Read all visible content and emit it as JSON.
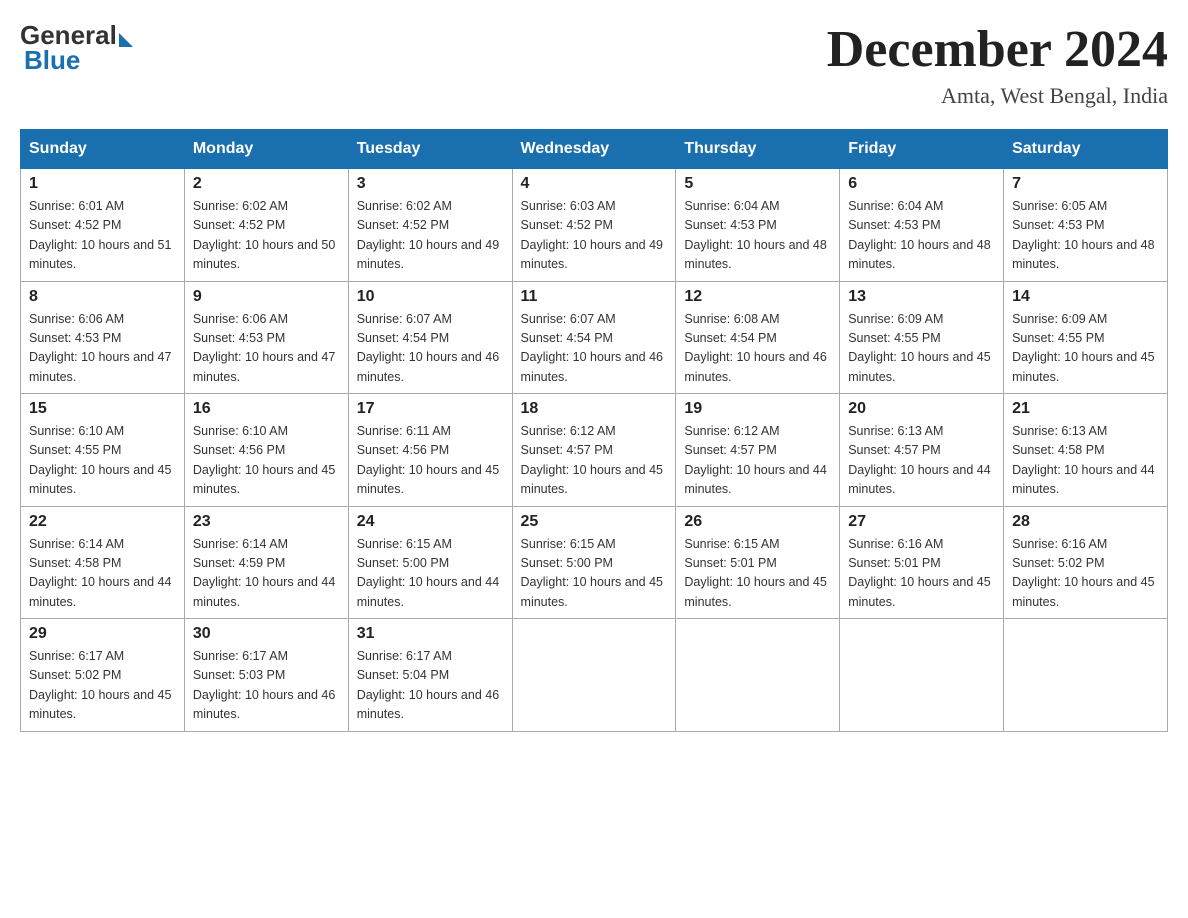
{
  "logo": {
    "general": "General",
    "blue": "Blue"
  },
  "title": "December 2024",
  "location": "Amta, West Bengal, India",
  "weekdays": [
    "Sunday",
    "Monday",
    "Tuesday",
    "Wednesday",
    "Thursday",
    "Friday",
    "Saturday"
  ],
  "weeks": [
    [
      {
        "day": 1,
        "sunrise": "6:01 AM",
        "sunset": "4:52 PM",
        "daylight": "10 hours and 51 minutes."
      },
      {
        "day": 2,
        "sunrise": "6:02 AM",
        "sunset": "4:52 PM",
        "daylight": "10 hours and 50 minutes."
      },
      {
        "day": 3,
        "sunrise": "6:02 AM",
        "sunset": "4:52 PM",
        "daylight": "10 hours and 49 minutes."
      },
      {
        "day": 4,
        "sunrise": "6:03 AM",
        "sunset": "4:52 PM",
        "daylight": "10 hours and 49 minutes."
      },
      {
        "day": 5,
        "sunrise": "6:04 AM",
        "sunset": "4:53 PM",
        "daylight": "10 hours and 48 minutes."
      },
      {
        "day": 6,
        "sunrise": "6:04 AM",
        "sunset": "4:53 PM",
        "daylight": "10 hours and 48 minutes."
      },
      {
        "day": 7,
        "sunrise": "6:05 AM",
        "sunset": "4:53 PM",
        "daylight": "10 hours and 48 minutes."
      }
    ],
    [
      {
        "day": 8,
        "sunrise": "6:06 AM",
        "sunset": "4:53 PM",
        "daylight": "10 hours and 47 minutes."
      },
      {
        "day": 9,
        "sunrise": "6:06 AM",
        "sunset": "4:53 PM",
        "daylight": "10 hours and 47 minutes."
      },
      {
        "day": 10,
        "sunrise": "6:07 AM",
        "sunset": "4:54 PM",
        "daylight": "10 hours and 46 minutes."
      },
      {
        "day": 11,
        "sunrise": "6:07 AM",
        "sunset": "4:54 PM",
        "daylight": "10 hours and 46 minutes."
      },
      {
        "day": 12,
        "sunrise": "6:08 AM",
        "sunset": "4:54 PM",
        "daylight": "10 hours and 46 minutes."
      },
      {
        "day": 13,
        "sunrise": "6:09 AM",
        "sunset": "4:55 PM",
        "daylight": "10 hours and 45 minutes."
      },
      {
        "day": 14,
        "sunrise": "6:09 AM",
        "sunset": "4:55 PM",
        "daylight": "10 hours and 45 minutes."
      }
    ],
    [
      {
        "day": 15,
        "sunrise": "6:10 AM",
        "sunset": "4:55 PM",
        "daylight": "10 hours and 45 minutes."
      },
      {
        "day": 16,
        "sunrise": "6:10 AM",
        "sunset": "4:56 PM",
        "daylight": "10 hours and 45 minutes."
      },
      {
        "day": 17,
        "sunrise": "6:11 AM",
        "sunset": "4:56 PM",
        "daylight": "10 hours and 45 minutes."
      },
      {
        "day": 18,
        "sunrise": "6:12 AM",
        "sunset": "4:57 PM",
        "daylight": "10 hours and 45 minutes."
      },
      {
        "day": 19,
        "sunrise": "6:12 AM",
        "sunset": "4:57 PM",
        "daylight": "10 hours and 44 minutes."
      },
      {
        "day": 20,
        "sunrise": "6:13 AM",
        "sunset": "4:57 PM",
        "daylight": "10 hours and 44 minutes."
      },
      {
        "day": 21,
        "sunrise": "6:13 AM",
        "sunset": "4:58 PM",
        "daylight": "10 hours and 44 minutes."
      }
    ],
    [
      {
        "day": 22,
        "sunrise": "6:14 AM",
        "sunset": "4:58 PM",
        "daylight": "10 hours and 44 minutes."
      },
      {
        "day": 23,
        "sunrise": "6:14 AM",
        "sunset": "4:59 PM",
        "daylight": "10 hours and 44 minutes."
      },
      {
        "day": 24,
        "sunrise": "6:15 AM",
        "sunset": "5:00 PM",
        "daylight": "10 hours and 44 minutes."
      },
      {
        "day": 25,
        "sunrise": "6:15 AM",
        "sunset": "5:00 PM",
        "daylight": "10 hours and 45 minutes."
      },
      {
        "day": 26,
        "sunrise": "6:15 AM",
        "sunset": "5:01 PM",
        "daylight": "10 hours and 45 minutes."
      },
      {
        "day": 27,
        "sunrise": "6:16 AM",
        "sunset": "5:01 PM",
        "daylight": "10 hours and 45 minutes."
      },
      {
        "day": 28,
        "sunrise": "6:16 AM",
        "sunset": "5:02 PM",
        "daylight": "10 hours and 45 minutes."
      }
    ],
    [
      {
        "day": 29,
        "sunrise": "6:17 AM",
        "sunset": "5:02 PM",
        "daylight": "10 hours and 45 minutes."
      },
      {
        "day": 30,
        "sunrise": "6:17 AM",
        "sunset": "5:03 PM",
        "daylight": "10 hours and 46 minutes."
      },
      {
        "day": 31,
        "sunrise": "6:17 AM",
        "sunset": "5:04 PM",
        "daylight": "10 hours and 46 minutes."
      },
      null,
      null,
      null,
      null
    ]
  ]
}
